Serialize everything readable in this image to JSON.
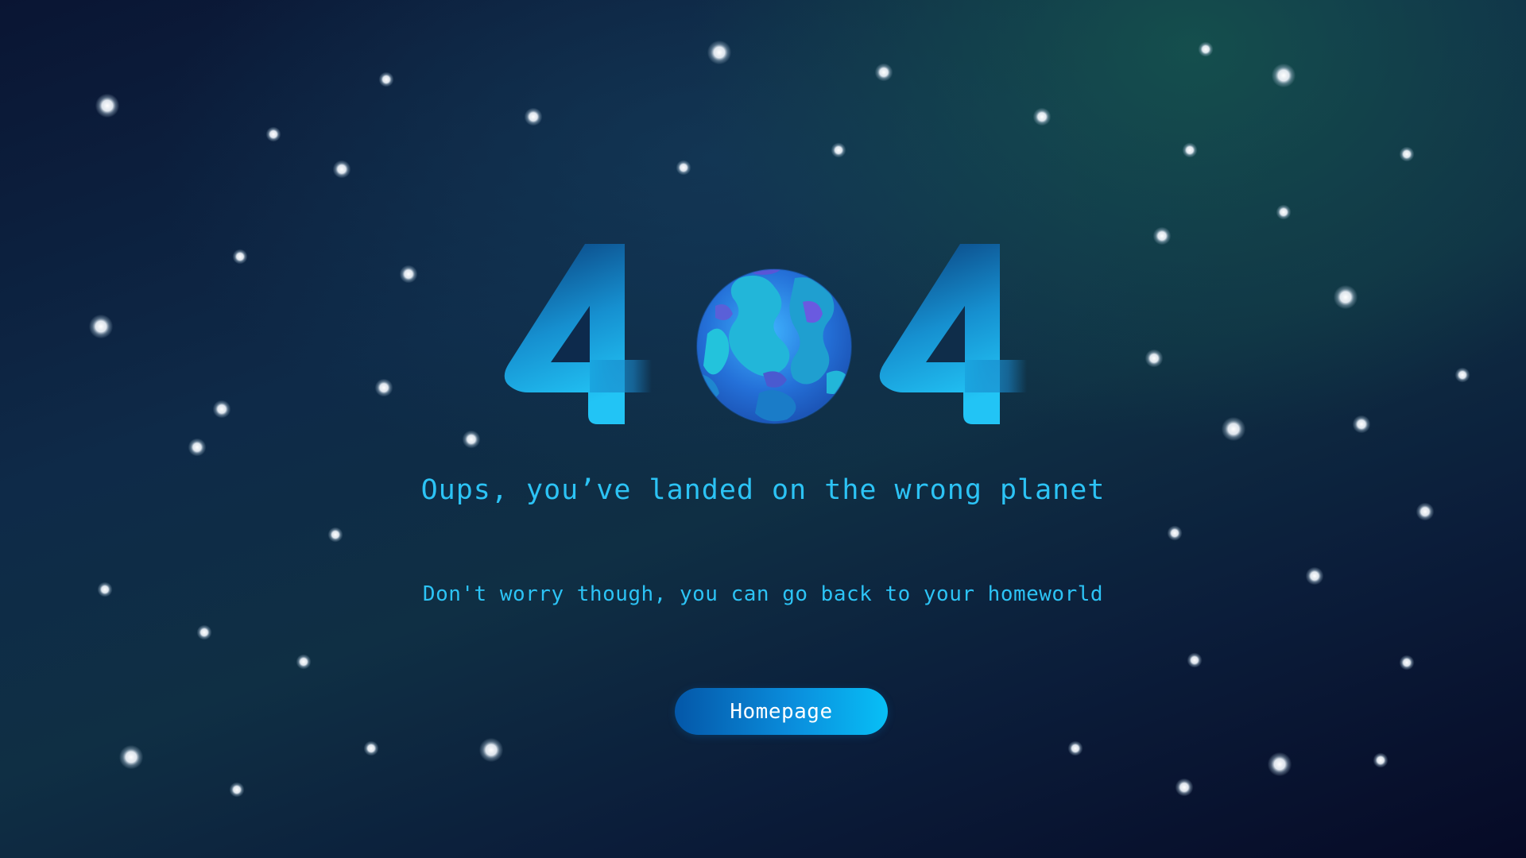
{
  "error_code": {
    "left_digit": "4",
    "right_digit": "4"
  },
  "headline": "Oups, you’ve landed on the wrong planet",
  "subline": "Don't worry though, you can go back to your homeworld",
  "homepage_button": {
    "label": "Homepage"
  },
  "colors": {
    "accent": "#2cc3f5",
    "button_start": "#0457a8",
    "button_end": "#08bff6",
    "background_dark": "#060a26",
    "background_teal": "#16554e"
  },
  "icons": {
    "planet": "planet-earth-icon",
    "stars": "star-dot-icon"
  }
}
